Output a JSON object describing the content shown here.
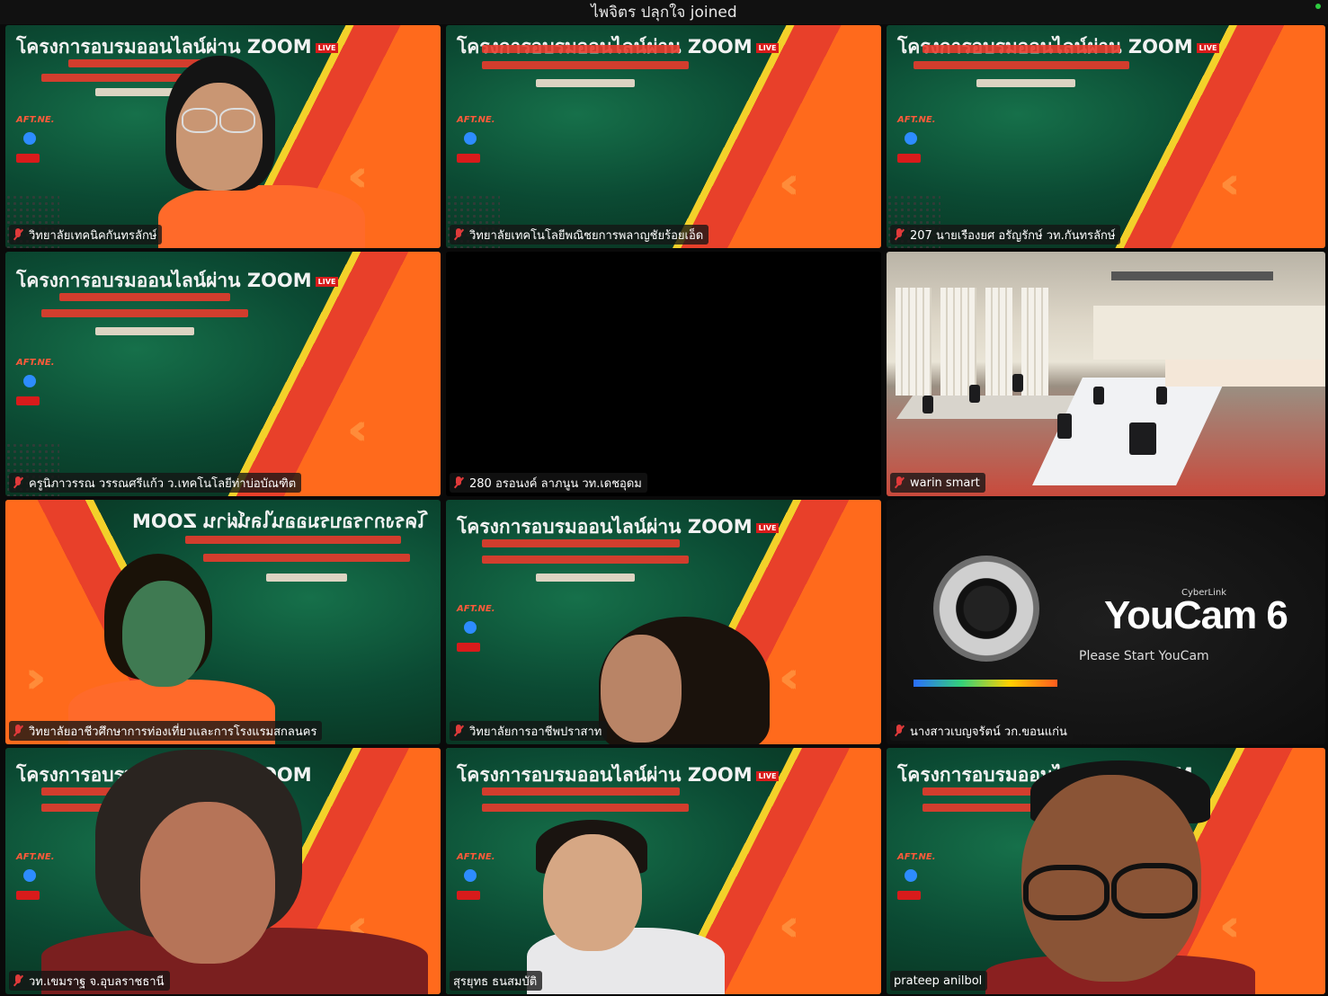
{
  "notification": {
    "text": "ไพจิตร ปลุกใจ joined"
  },
  "banner": {
    "title": "โครงการอบรมออนไลน์ผ่าน ZOOM",
    "live": "LIVE",
    "logo_text": "AFT.NE."
  },
  "youcam": {
    "brand_small": "CyberLink",
    "brand": "YouCam 6",
    "sub": "Please Start YouCam"
  },
  "participants": [
    {
      "name": "วิทยาลัยเทคนิคกันทรลักษ์",
      "muted": true
    },
    {
      "name": "วิทยาลัยเทคโนโลยีพณิชยการพลาญชัยร้อยเอ็ด",
      "muted": true
    },
    {
      "name": "207 นายเรืองยศ  อรัญรักษ์ วท.กันทรลักษ์",
      "muted": true
    },
    {
      "name": "ครูนิภาวรรณ วรรณศรีแก้ว ว.เทคโนโลยีท่าบ่อบัณฑิต",
      "muted": true
    },
    {
      "name": "280 อรอนงค์ ลาภนูน วท.เดชอุดม",
      "muted": true
    },
    {
      "name": "warin smart",
      "muted": true
    },
    {
      "name": "วิทยาลัยอาชีวศึกษาการท่องเที่ยวและการโรงแรมสกลนคร",
      "muted": true
    },
    {
      "name": "วิทยาลัยการอาชีพปราสาท",
      "muted": true
    },
    {
      "name": "นางสาวเบญจรัตน์ วก.ขอนแก่น",
      "muted": true
    },
    {
      "name": "วท.เขมราฐ จ.อุบลราชธานี",
      "muted": true
    },
    {
      "name": "สุรยุทธ ธนสมบัติ",
      "muted": false
    },
    {
      "name": "prateep anilbol",
      "muted": false
    }
  ],
  "colors": {
    "active_speaker": "#35d04a",
    "muted": "#e03a3a"
  }
}
